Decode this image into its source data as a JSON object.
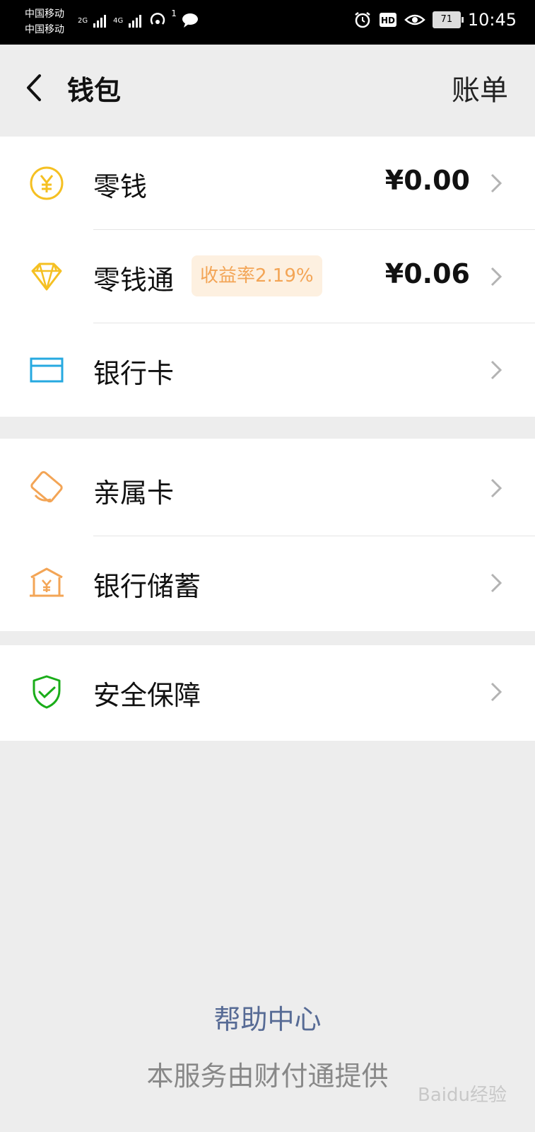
{
  "status_bar": {
    "carrier1": "中国移动",
    "carrier2": "中国移动",
    "net1": "2G",
    "net2": "4G",
    "hotspot_count": "1",
    "battery": "71",
    "time": "10:45"
  },
  "nav": {
    "title": "钱包",
    "bill": "账单"
  },
  "groups": [
    {
      "items": [
        {
          "label": "零钱",
          "amount": "¥0.00",
          "icon": "yen-coin-icon",
          "color": "#f5c022"
        },
        {
          "label": "零钱通",
          "badge": "收益率2.19%",
          "amount": "¥0.06",
          "icon": "diamond-icon",
          "color": "#f5c022"
        },
        {
          "label": "银行卡",
          "icon": "bank-card-icon",
          "color": "#26a9e0"
        }
      ]
    },
    {
      "items": [
        {
          "label": "亲属卡",
          "icon": "family-card-icon",
          "color": "#f3a556"
        },
        {
          "label": "银行储蓄",
          "icon": "bank-savings-icon",
          "color": "#f3a556"
        }
      ]
    },
    {
      "items": [
        {
          "label": "安全保障",
          "icon": "shield-check-icon",
          "color": "#1aad19"
        }
      ]
    }
  ],
  "footer": {
    "help": "帮助中心",
    "provider": "本服务由财付通提供"
  },
  "watermark": "Baidu经验"
}
